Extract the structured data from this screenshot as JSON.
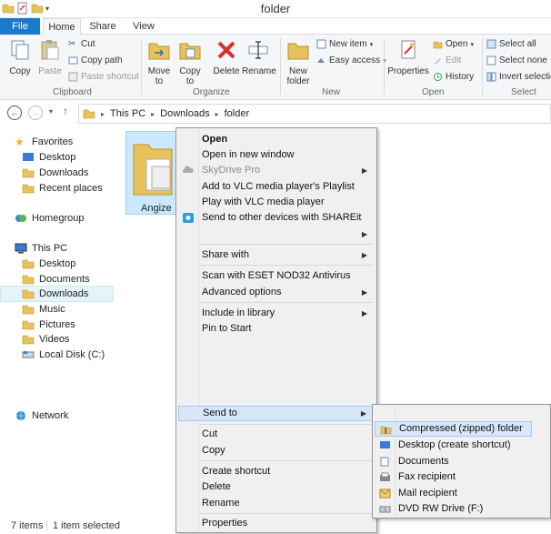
{
  "window": {
    "title": "folder"
  },
  "tabs": {
    "file": "File",
    "home": "Home",
    "share": "Share",
    "view": "View"
  },
  "ribbon": {
    "clipboard": {
      "label": "Clipboard",
      "copy": "Copy",
      "paste": "Paste",
      "cut": "Cut",
      "copy_path": "Copy path",
      "paste_shortcut": "Paste shortcut"
    },
    "organize": {
      "label": "Organize",
      "move_to": "Move",
      "move_to_2": "to",
      "copy_to": "Copy",
      "copy_to_2": "to",
      "delete": "Delete",
      "rename": "Rename"
    },
    "new": {
      "label": "New",
      "new_folder": "New",
      "new_folder_2": "folder",
      "new_item": "New item",
      "easy_access": "Easy access"
    },
    "open": {
      "label": "Open",
      "properties": "Properties",
      "open": "Open",
      "edit": "Edit",
      "history": "History"
    },
    "select": {
      "label": "Select",
      "select_all": "Select all",
      "select_none": "Select none",
      "invert": "Invert selection"
    }
  },
  "address": {
    "crumbs": [
      "This PC",
      "Downloads",
      "folder"
    ]
  },
  "nav": {
    "favorites": "Favorites",
    "desktop": "Desktop",
    "downloads": "Downloads",
    "recent": "Recent places",
    "homegroup": "Homegroup",
    "this_pc": "This PC",
    "pc_desktop": "Desktop",
    "documents": "Documents",
    "pc_downloads": "Downloads",
    "music": "Music",
    "pictures": "Pictures",
    "videos": "Videos",
    "local_disk": "Local Disk (C:)",
    "network": "Network"
  },
  "content": {
    "file_label": "Angize"
  },
  "status": {
    "items": "7 items",
    "selected": "1 item selected"
  },
  "context_menu": {
    "open": "Open",
    "open_new_window": "Open in new window",
    "skydrive": "SkyDrive Pro",
    "vlc_playlist": "Add to VLC media player's Playlist",
    "vlc_play": "Play with VLC media player",
    "shareit": "Send to other devices with SHAREit",
    "share_with": "Share with",
    "scan_eset": "Scan with ESET NOD32 Antivirus",
    "advanced": "Advanced options",
    "include_library": "Include in library",
    "pin_start": "Pin to Start",
    "send_to": "Send to",
    "cut": "Cut",
    "copy": "Copy",
    "create_shortcut": "Create shortcut",
    "delete": "Delete",
    "rename": "Rename",
    "properties": "Properties"
  },
  "send_to_menu": {
    "compressed": "Compressed (zipped) folder",
    "desktop_shortcut": "Desktop (create shortcut)",
    "documents": "Documents",
    "fax": "Fax recipient",
    "mail": "Mail recipient",
    "dvd": "DVD RW Drive (F:)"
  },
  "colors": {
    "accent": "#1979ca",
    "highlight": "#d6e8f8",
    "folder": "#e8c25a"
  }
}
